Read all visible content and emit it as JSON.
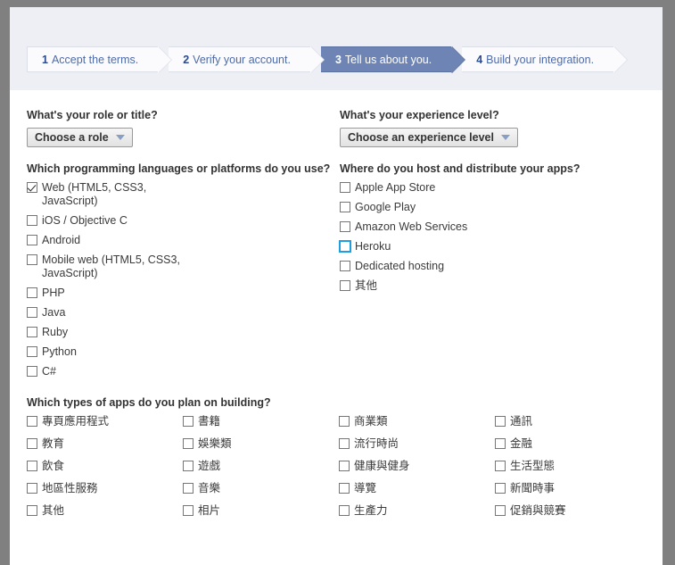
{
  "steps": [
    {
      "num": "1",
      "text": "Accept the terms.",
      "active": false
    },
    {
      "num": "2",
      "text": "Verify your account.",
      "active": false
    },
    {
      "num": "3",
      "text": "Tell us about you.",
      "active": true
    },
    {
      "num": "4",
      "text": "Build your integration.",
      "active": false
    }
  ],
  "role": {
    "question": "What's your role or title?",
    "selected": "Choose a role"
  },
  "experience": {
    "question": "What's your experience level?",
    "selected": "Choose an experience level"
  },
  "languages": {
    "question": "Which programming languages or platforms do you use?",
    "options": [
      {
        "label": "Web (HTML5, CSS3, JavaScript)",
        "checked": true,
        "focused": false
      },
      {
        "label": "iOS / Objective C",
        "checked": false,
        "focused": false
      },
      {
        "label": "Android",
        "checked": false,
        "focused": false
      },
      {
        "label": "Mobile web (HTML5, CSS3, JavaScript)",
        "checked": false,
        "focused": false
      },
      {
        "label": "PHP",
        "checked": false,
        "focused": false
      },
      {
        "label": "Java",
        "checked": false,
        "focused": false
      },
      {
        "label": "Ruby",
        "checked": false,
        "focused": false
      },
      {
        "label": "Python",
        "checked": false,
        "focused": false
      },
      {
        "label": "C#",
        "checked": false,
        "focused": false
      }
    ]
  },
  "hosting": {
    "question": "Where do you host and distribute your apps?",
    "options": [
      {
        "label": "Apple App Store",
        "checked": false,
        "focused": false
      },
      {
        "label": "Google Play",
        "checked": false,
        "focused": false
      },
      {
        "label": "Amazon Web Services",
        "checked": false,
        "focused": false
      },
      {
        "label": "Heroku",
        "checked": false,
        "focused": true
      },
      {
        "label": "Dedicated hosting",
        "checked": false,
        "focused": false
      },
      {
        "label": "其他",
        "checked": false,
        "focused": false
      }
    ]
  },
  "app_types": {
    "question": "Which types of apps do you plan on building?",
    "columns": [
      [
        {
          "label": "專頁應用程式",
          "checked": false
        },
        {
          "label": "教育",
          "checked": false
        },
        {
          "label": "飲食",
          "checked": false
        },
        {
          "label": "地區性服務",
          "checked": false
        },
        {
          "label": "其他",
          "checked": false
        }
      ],
      [
        {
          "label": "書籍",
          "checked": false
        },
        {
          "label": "娛樂類",
          "checked": false
        },
        {
          "label": "遊戲",
          "checked": false
        },
        {
          "label": "音樂",
          "checked": false
        },
        {
          "label": "相片",
          "checked": false
        }
      ],
      [
        {
          "label": "商業類",
          "checked": false
        },
        {
          "label": "流行時尚",
          "checked": false
        },
        {
          "label": "健康與健身",
          "checked": false
        },
        {
          "label": "導覽",
          "checked": false
        },
        {
          "label": "生產力",
          "checked": false
        }
      ],
      [
        {
          "label": "通訊",
          "checked": false
        },
        {
          "label": "金融",
          "checked": false
        },
        {
          "label": "生活型態",
          "checked": false
        },
        {
          "label": "新聞時事",
          "checked": false
        },
        {
          "label": "促銷與競賽",
          "checked": false
        }
      ]
    ]
  },
  "colors": {
    "active_step_bg": "#6d84b4",
    "step_text": "#3b5998",
    "header_bg": "#edeff4",
    "frame_bg": "#808080",
    "focus_outline": "#1ea0e0"
  }
}
